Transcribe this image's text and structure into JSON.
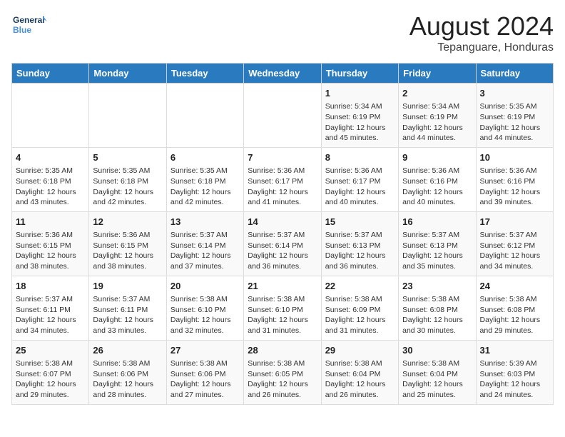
{
  "logo": {
    "line1": "General",
    "line2": "Blue"
  },
  "title": "August 2024",
  "subtitle": "Tepanguare, Honduras",
  "days_of_week": [
    "Sunday",
    "Monday",
    "Tuesday",
    "Wednesday",
    "Thursday",
    "Friday",
    "Saturday"
  ],
  "weeks": [
    [
      {
        "day": "",
        "info": ""
      },
      {
        "day": "",
        "info": ""
      },
      {
        "day": "",
        "info": ""
      },
      {
        "day": "",
        "info": ""
      },
      {
        "day": "1",
        "info": "Sunrise: 5:34 AM\nSunset: 6:19 PM\nDaylight: 12 hours\nand 45 minutes."
      },
      {
        "day": "2",
        "info": "Sunrise: 5:34 AM\nSunset: 6:19 PM\nDaylight: 12 hours\nand 44 minutes."
      },
      {
        "day": "3",
        "info": "Sunrise: 5:35 AM\nSunset: 6:19 PM\nDaylight: 12 hours\nand 44 minutes."
      }
    ],
    [
      {
        "day": "4",
        "info": "Sunrise: 5:35 AM\nSunset: 6:18 PM\nDaylight: 12 hours\nand 43 minutes."
      },
      {
        "day": "5",
        "info": "Sunrise: 5:35 AM\nSunset: 6:18 PM\nDaylight: 12 hours\nand 42 minutes."
      },
      {
        "day": "6",
        "info": "Sunrise: 5:35 AM\nSunset: 6:18 PM\nDaylight: 12 hours\nand 42 minutes."
      },
      {
        "day": "7",
        "info": "Sunrise: 5:36 AM\nSunset: 6:17 PM\nDaylight: 12 hours\nand 41 minutes."
      },
      {
        "day": "8",
        "info": "Sunrise: 5:36 AM\nSunset: 6:17 PM\nDaylight: 12 hours\nand 40 minutes."
      },
      {
        "day": "9",
        "info": "Sunrise: 5:36 AM\nSunset: 6:16 PM\nDaylight: 12 hours\nand 40 minutes."
      },
      {
        "day": "10",
        "info": "Sunrise: 5:36 AM\nSunset: 6:16 PM\nDaylight: 12 hours\nand 39 minutes."
      }
    ],
    [
      {
        "day": "11",
        "info": "Sunrise: 5:36 AM\nSunset: 6:15 PM\nDaylight: 12 hours\nand 38 minutes."
      },
      {
        "day": "12",
        "info": "Sunrise: 5:36 AM\nSunset: 6:15 PM\nDaylight: 12 hours\nand 38 minutes."
      },
      {
        "day": "13",
        "info": "Sunrise: 5:37 AM\nSunset: 6:14 PM\nDaylight: 12 hours\nand 37 minutes."
      },
      {
        "day": "14",
        "info": "Sunrise: 5:37 AM\nSunset: 6:14 PM\nDaylight: 12 hours\nand 36 minutes."
      },
      {
        "day": "15",
        "info": "Sunrise: 5:37 AM\nSunset: 6:13 PM\nDaylight: 12 hours\nand 36 minutes."
      },
      {
        "day": "16",
        "info": "Sunrise: 5:37 AM\nSunset: 6:13 PM\nDaylight: 12 hours\nand 35 minutes."
      },
      {
        "day": "17",
        "info": "Sunrise: 5:37 AM\nSunset: 6:12 PM\nDaylight: 12 hours\nand 34 minutes."
      }
    ],
    [
      {
        "day": "18",
        "info": "Sunrise: 5:37 AM\nSunset: 6:11 PM\nDaylight: 12 hours\nand 34 minutes."
      },
      {
        "day": "19",
        "info": "Sunrise: 5:37 AM\nSunset: 6:11 PM\nDaylight: 12 hours\nand 33 minutes."
      },
      {
        "day": "20",
        "info": "Sunrise: 5:38 AM\nSunset: 6:10 PM\nDaylight: 12 hours\nand 32 minutes."
      },
      {
        "day": "21",
        "info": "Sunrise: 5:38 AM\nSunset: 6:10 PM\nDaylight: 12 hours\nand 31 minutes."
      },
      {
        "day": "22",
        "info": "Sunrise: 5:38 AM\nSunset: 6:09 PM\nDaylight: 12 hours\nand 31 minutes."
      },
      {
        "day": "23",
        "info": "Sunrise: 5:38 AM\nSunset: 6:08 PM\nDaylight: 12 hours\nand 30 minutes."
      },
      {
        "day": "24",
        "info": "Sunrise: 5:38 AM\nSunset: 6:08 PM\nDaylight: 12 hours\nand 29 minutes."
      }
    ],
    [
      {
        "day": "25",
        "info": "Sunrise: 5:38 AM\nSunset: 6:07 PM\nDaylight: 12 hours\nand 29 minutes."
      },
      {
        "day": "26",
        "info": "Sunrise: 5:38 AM\nSunset: 6:06 PM\nDaylight: 12 hours\nand 28 minutes."
      },
      {
        "day": "27",
        "info": "Sunrise: 5:38 AM\nSunset: 6:06 PM\nDaylight: 12 hours\nand 27 minutes."
      },
      {
        "day": "28",
        "info": "Sunrise: 5:38 AM\nSunset: 6:05 PM\nDaylight: 12 hours\nand 26 minutes."
      },
      {
        "day": "29",
        "info": "Sunrise: 5:38 AM\nSunset: 6:04 PM\nDaylight: 12 hours\nand 26 minutes."
      },
      {
        "day": "30",
        "info": "Sunrise: 5:38 AM\nSunset: 6:04 PM\nDaylight: 12 hours\nand 25 minutes."
      },
      {
        "day": "31",
        "info": "Sunrise: 5:39 AM\nSunset: 6:03 PM\nDaylight: 12 hours\nand 24 minutes."
      }
    ]
  ]
}
